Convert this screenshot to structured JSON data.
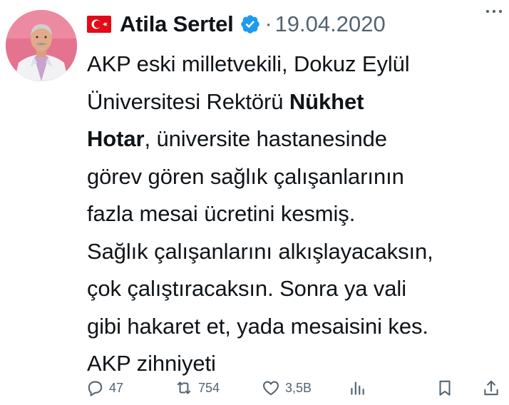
{
  "tweet": {
    "author_name": "Atila Sertel",
    "separator": "·",
    "date": "19.04.2020",
    "body_lines": [
      [
        "AKP eski milletvekili, Dokuz Eylül",
        ""
      ],
      [
        "Üniversitesi Rektörü ",
        "Nükhet"
      ],
      [
        "",
        "Hotar"
      ],
      [
        "görev gören sağlık çalışanlarının",
        ""
      ],
      [
        "fazla mesai ücretini kesmiş.",
        ""
      ],
      [
        "Sağlık çalışanlarını alkışlayacaksın,",
        ""
      ],
      [
        "çok çalıştıracaksın. Sonra ya vali",
        ""
      ],
      [
        "gibi hakaret et, yada mesaisini kes.",
        ""
      ],
      [
        "AKP zihniyeti",
        ""
      ]
    ],
    "line3_tail": ", üniversite hastanesinde"
  },
  "actions": {
    "replies": "47",
    "retweets": "754",
    "likes": "3,5B"
  },
  "icons": {
    "flag": "turkey-flag-icon",
    "verified": "verified-badge-icon",
    "more": "more-options-icon",
    "reply": "reply-icon",
    "retweet": "retweet-icon",
    "like": "heart-icon",
    "views": "analytics-icon",
    "bookmark": "bookmark-icon",
    "share": "share-icon"
  },
  "colors": {
    "verified_blue": "#1d9bf0",
    "muted": "#536471",
    "text": "#0f1419",
    "flag_red": "#e30a17"
  }
}
